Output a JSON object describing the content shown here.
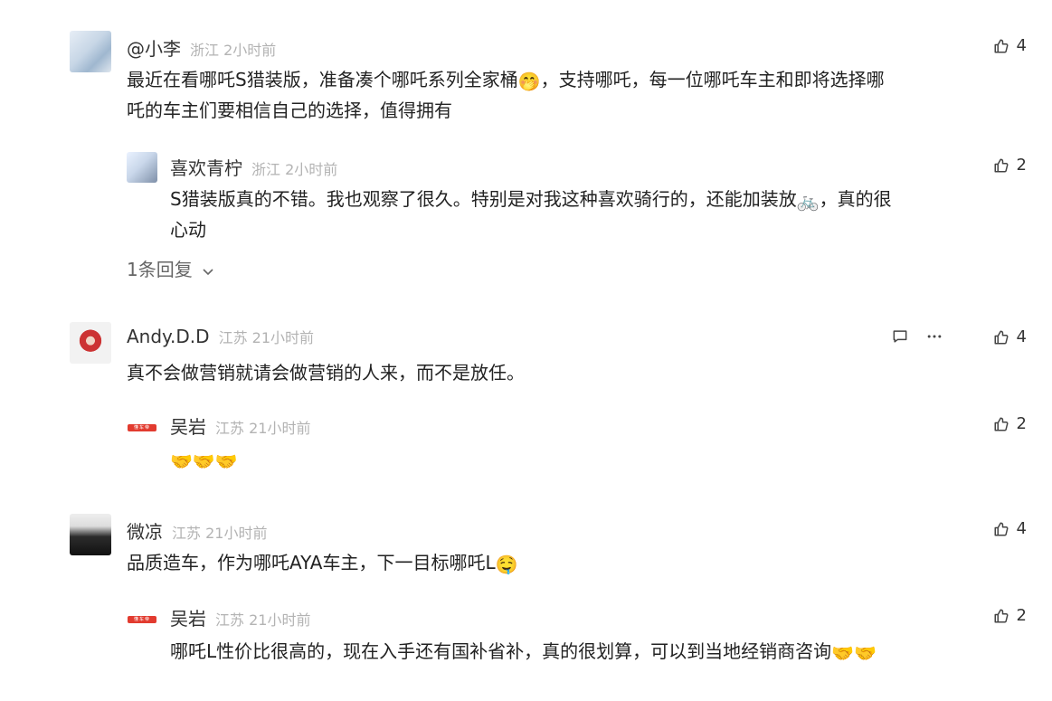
{
  "comments": [
    {
      "name": "@小李",
      "region": "浙江",
      "time": "2小时前",
      "likes": "4",
      "text_line1": "最近在看哪吒S猎装版，准备凑个哪吒系列全家桶",
      "emoji_1": "🤭",
      "text_line1b": "，支持哪吒，每一位哪吒车主和即将选择哪",
      "text_line2": "吒的车主们要相信自己的选择，值得拥有",
      "reply": {
        "name": "喜欢青柠",
        "region": "浙江",
        "time": "2小时前",
        "likes": "2",
        "text_line1": "S猎装版真的不错。我也观察了很久。特别是对我这种喜欢骑行的，还能加装放",
        "emoji": "🚲",
        "text_line1b": "，真的很",
        "text_line2": "心动"
      },
      "reply_count": "1条回复"
    },
    {
      "name": "Andy.D.D",
      "region": "江苏",
      "time": "21小时前",
      "likes": "4",
      "text": "真不会做营销就请会做营销的人来，而不是放任。",
      "reply": {
        "name": "吴岩",
        "region": "江苏",
        "time": "21小时前",
        "likes": "2",
        "badge": "懂车帝",
        "emoji_text": "🤝🤝🤝"
      }
    },
    {
      "name": "微凉",
      "region": "江苏",
      "time": "21小时前",
      "likes": "4",
      "text": "品质造车，作为哪吒AYA车主，下一目标哪吒L",
      "emoji": "🤤",
      "reply": {
        "name": "吴岩",
        "region": "江苏",
        "time": "21小时前",
        "likes": "2",
        "badge": "懂车帝",
        "text": "哪吒L性价比很高的，现在入手还有国补省补，真的很划算，可以到当地经销商咨询",
        "emoji_text": "🤝🤝"
      }
    }
  ],
  "icons": {
    "thumb": "thumbs-up-icon",
    "comment": "comment-icon",
    "more": "more-icon",
    "chevron": "chevron-down-icon"
  }
}
